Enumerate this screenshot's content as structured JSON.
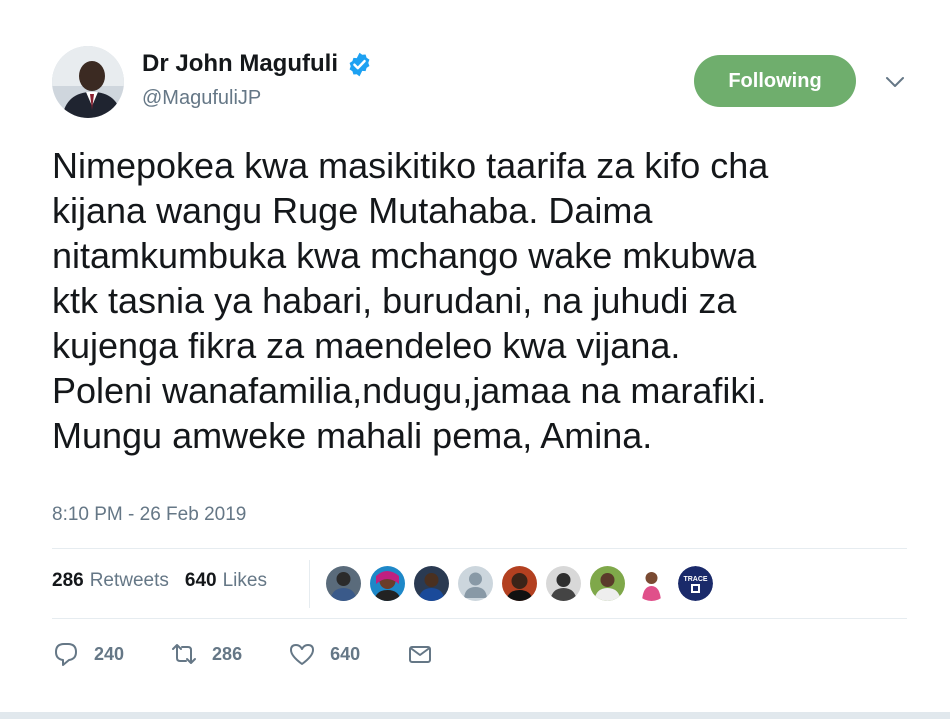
{
  "header": {
    "display_name": "Dr John Magufuli",
    "handle": "@MagufuliJP",
    "verified_icon": "verified-badge-icon",
    "follow_button_label": "Following",
    "menu_icon": "chevron-down-icon"
  },
  "tweet": {
    "text": "Nimepokea kwa masikitiko taarifa za kifo cha\nkijana wangu Ruge Mutahaba. Daima\nnitamkumbuka kwa mchango wake mkubwa\nktk tasnia ya habari, burudani, na juhudi za\nkujenga fikra za maendeleo kwa vijana.\nPoleni wanafamilia,ndugu,jamaa na marafiki.\nMungu amweke mahali pema, Amina.",
    "timestamp": "8:10 PM - 26 Feb 2019"
  },
  "stats": {
    "retweets_count": "286",
    "retweets_label": "Retweets",
    "likes_count": "640",
    "likes_label": "Likes"
  },
  "likers": [
    {
      "icon": "user-avatar"
    },
    {
      "icon": "user-avatar"
    },
    {
      "icon": "user-avatar"
    },
    {
      "icon": "default-avatar"
    },
    {
      "icon": "user-avatar"
    },
    {
      "icon": "user-avatar"
    },
    {
      "icon": "user-avatar"
    },
    {
      "icon": "user-avatar"
    },
    {
      "icon": "trace-logo-avatar",
      "text": "TRACE"
    }
  ],
  "actions": {
    "reply_count": "240",
    "retweet_count": "286",
    "like_count": "640"
  },
  "colors": {
    "follow_button": "#6fae6d",
    "verified": "#1da1f2",
    "muted_text": "#657786"
  }
}
